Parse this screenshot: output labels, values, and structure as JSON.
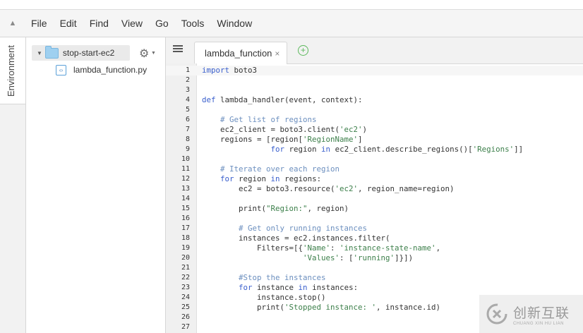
{
  "menu": {
    "items": [
      "File",
      "Edit",
      "Find",
      "View",
      "Go",
      "Tools",
      "Window"
    ]
  },
  "sidebar": {
    "environment_label": "Environment"
  },
  "tree": {
    "root": "stop-start-ec2",
    "file": "lambda_function.py"
  },
  "editor": {
    "tab_label": "lambda_function",
    "close_glyph": "×",
    "add_glyph": "+",
    "lines": [
      {
        "no": "1",
        "code": "import boto3"
      },
      {
        "no": "2",
        "code": ""
      },
      {
        "no": "3",
        "code": ""
      },
      {
        "no": "4",
        "code": "def lambda_handler(event, context):"
      },
      {
        "no": "5",
        "code": ""
      },
      {
        "no": "6",
        "code": "    # Get list of regions"
      },
      {
        "no": "7",
        "code": "    ec2_client = boto3.client('ec2')"
      },
      {
        "no": "8",
        "code": "    regions = [region['RegionName']"
      },
      {
        "no": "9",
        "code": "               for region in ec2_client.describe_regions()['Regions']]"
      },
      {
        "no": "10",
        "code": ""
      },
      {
        "no": "11",
        "code": "    # Iterate over each region"
      },
      {
        "no": "12",
        "code": "    for region in regions:"
      },
      {
        "no": "13",
        "code": "        ec2 = boto3.resource('ec2', region_name=region)"
      },
      {
        "no": "14",
        "code": ""
      },
      {
        "no": "15",
        "code": "        print(\"Region:\", region)"
      },
      {
        "no": "16",
        "code": ""
      },
      {
        "no": "17",
        "code": "        # Get only running instances"
      },
      {
        "no": "18",
        "code": "        instances = ec2.instances.filter("
      },
      {
        "no": "19",
        "code": "            Filters=[{'Name': 'instance-state-name',"
      },
      {
        "no": "20",
        "code": "                      'Values': ['running']}])"
      },
      {
        "no": "21",
        "code": ""
      },
      {
        "no": "22",
        "code": "        #Stop the instances"
      },
      {
        "no": "23",
        "code": "        for instance in instances:"
      },
      {
        "no": "24",
        "code": "            instance.stop()"
      },
      {
        "no": "25",
        "code": "            print('Stopped instance: ', instance.id)"
      },
      {
        "no": "26",
        "code": ""
      },
      {
        "no": "27",
        "code": ""
      }
    ]
  },
  "watermark": {
    "cn": "创新互联",
    "en": "CHUANG XIN HU LIAN"
  },
  "colors": {
    "keyword": "#3a5fcd",
    "string": "#3c7f4a",
    "comment": "#6c8fbf"
  },
  "icons": {
    "menu_toggle": "triangle-up-icon",
    "folder": "folder-icon",
    "file": "python-file-icon",
    "gear": "gear-icon",
    "tabs": "tabs-list-icon",
    "add_tab": "plus-circle-icon"
  }
}
